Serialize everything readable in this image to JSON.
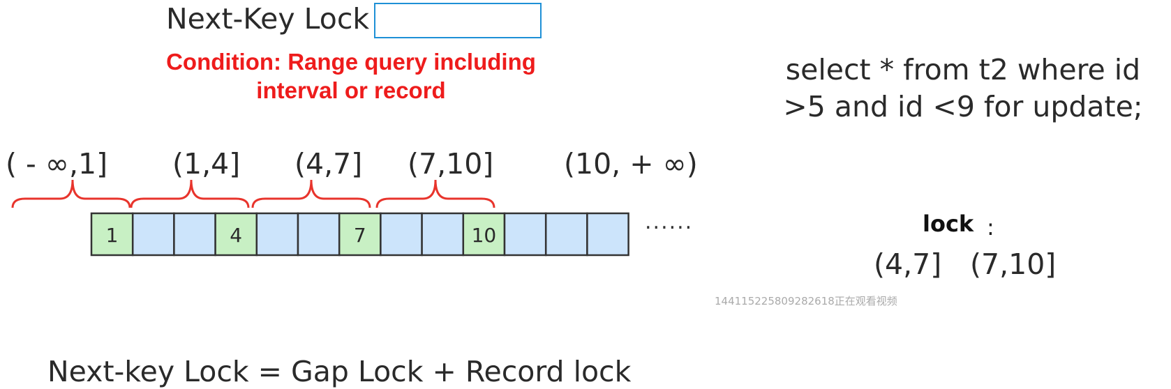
{
  "title": "Next-Key Lock",
  "condition": "Condition: Range query including interval or record",
  "query": "select * from t2 where id >5 and id <9 for update;",
  "intervals": [
    "( - ∞,1]",
    "(1,4]",
    "(4,7]",
    "(7,10]",
    "(10,  + ∞)"
  ],
  "cells": [
    {
      "label": "1",
      "record": true
    },
    {
      "label": "",
      "record": false
    },
    {
      "label": "",
      "record": false
    },
    {
      "label": "4",
      "record": true
    },
    {
      "label": "",
      "record": false
    },
    {
      "label": "",
      "record": false
    },
    {
      "label": "7",
      "record": true
    },
    {
      "label": "",
      "record": false
    },
    {
      "label": "",
      "record": false
    },
    {
      "label": "10",
      "record": true
    },
    {
      "label": "",
      "record": false
    },
    {
      "label": "",
      "record": false
    },
    {
      "label": "",
      "record": false
    }
  ],
  "ellipsis": "......",
  "lock": {
    "label": "lock",
    "colon": ":",
    "intervals": [
      "(4,7]",
      "(7,10]"
    ]
  },
  "watermark": "14411522580928261​8正在观看视频",
  "formula": "Next-key Lock  = Gap Lock + Record lock",
  "colors": {
    "record_cell": "#c8f0c4",
    "gap_cell": "#cce4fb",
    "brace": "#e8342c",
    "condition": "#ee1c1c",
    "title_box_border": "#1e90d6"
  }
}
